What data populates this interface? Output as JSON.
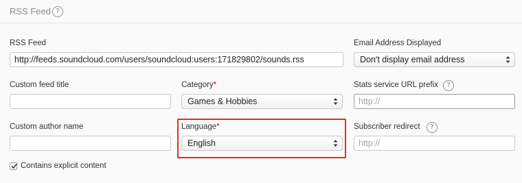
{
  "section": {
    "title": "RSS Feed",
    "help": "?"
  },
  "fields": {
    "rss_feed": {
      "label": "RSS Feed",
      "value": "http://feeds.soundcloud.com/users/soundcloud:users:171829802/sounds.rss"
    },
    "email_displayed": {
      "label": "Email Address Displayed",
      "selected": "Don't display email address"
    },
    "custom_feed_title": {
      "label": "Custom feed title",
      "value": ""
    },
    "category": {
      "label": "Category",
      "required_mark": "*",
      "selected": "Games & Hobbies"
    },
    "stats_prefix": {
      "label": "Stats service URL prefix",
      "help": "?",
      "placeholder": "http://"
    },
    "custom_author": {
      "label": "Custom author name",
      "value": ""
    },
    "language": {
      "label": "Language",
      "required_mark": "*",
      "selected": "English"
    },
    "subscriber_redirect": {
      "label": "Subscriber redirect",
      "help": "?",
      "placeholder": "http://"
    },
    "explicit": {
      "label": "Contains explicit content",
      "checked": true
    }
  },
  "icons": {
    "select_arrows": "up-down-chevron-icon",
    "help": "question-circle-icon",
    "check": "checkmark-icon"
  },
  "colors": {
    "highlight": "#e0301e",
    "required": "#d0021b"
  }
}
